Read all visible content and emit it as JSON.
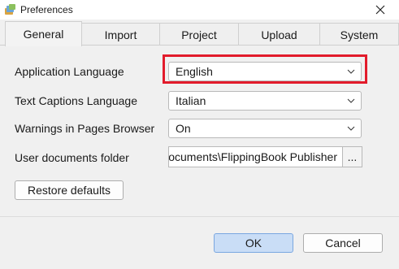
{
  "window": {
    "title": "Preferences"
  },
  "tabs": [
    {
      "label": "General",
      "active": true
    },
    {
      "label": "Import",
      "active": false
    },
    {
      "label": "Project",
      "active": false
    },
    {
      "label": "Upload",
      "active": false
    },
    {
      "label": "System",
      "active": false
    }
  ],
  "general": {
    "app_language": {
      "label": "Application Language",
      "value": "English"
    },
    "captions_language": {
      "label": "Text Captions Language",
      "value": "Italian"
    },
    "warnings": {
      "label": "Warnings in Pages Browser",
      "value": "On"
    },
    "user_folder": {
      "label": "User documents folder",
      "value": "ocuments\\FlippingBook Publisher",
      "browse_label": "..."
    },
    "restore_label": "Restore defaults"
  },
  "footer": {
    "ok_label": "OK",
    "cancel_label": "Cancel"
  },
  "colors": {
    "highlight": "#e21b2b",
    "ok_button": "#c9ddf6"
  },
  "icons": {
    "app": "paint-palette-icon",
    "close": "close-icon",
    "dropdown": "chevron-down-icon"
  }
}
